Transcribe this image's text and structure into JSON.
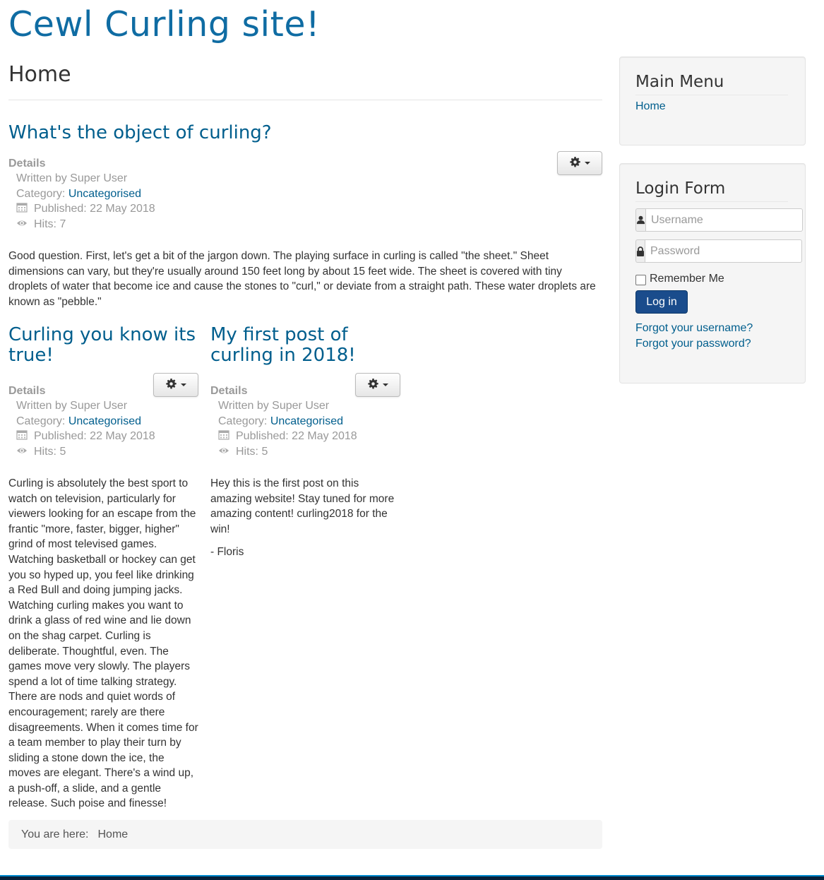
{
  "site": {
    "title": "Cewl Curling site!"
  },
  "page": {
    "title": "Home"
  },
  "articles": [
    {
      "title": "What's the object of curling?",
      "details_label": "Details",
      "author": "Written by Super User",
      "category_label": "Category:",
      "category": "Uncategorised",
      "published": "Published: 22 May 2018",
      "hits": "Hits: 7",
      "body": "Good question. First, let's get a bit of the jargon down. The playing surface in curling is called \"the sheet.\" Sheet dimensions can vary, but they're usually around 150 feet long by about 15 feet wide. The sheet is covered with tiny droplets of water that become ice and cause the stones to \"curl,\" or deviate from a straight path. These water droplets are known as \"pebble.\""
    },
    {
      "title": "Curling you know its true!",
      "details_label": "Details",
      "author": "Written by Super User",
      "category_label": "Category:",
      "category": "Uncategorised",
      "published": "Published: 22 May 2018",
      "hits": "Hits: 5",
      "body": "Curling is absolutely the best sport to watch on television, particularly for viewers looking for an escape from the frantic \"more, faster, bigger, higher\" grind of most televised games. Watching basketball or hockey can get you so hyped up, you feel like drinking a Red Bull and doing jumping jacks. Watching curling makes you want to drink a glass of red wine and lie down on the shag carpet. Curling is deliberate. Thoughtful, even. The games move very slowly. The players spend a lot of time talking strategy. There are nods and quiet words of encouragement; rarely are there disagreements. When it comes time for a team member to play their turn by sliding a stone down the ice, the moves are elegant. There's a wind up, a push-off, a slide, and a gentle release. Such poise and finesse!"
    },
    {
      "title": "My first post of curling in 2018!",
      "details_label": "Details",
      "author": "Written by Super User",
      "category_label": "Category:",
      "category": "Uncategorised",
      "published": "Published: 22 May 2018",
      "hits": "Hits: 5",
      "body": "Hey this is the first post on this amazing website! Stay tuned for more amazing content! curling2018 for the win!",
      "signature": "- Floris"
    }
  ],
  "main_menu": {
    "title": "Main Menu",
    "items": [
      "Home"
    ]
  },
  "login": {
    "title": "Login Form",
    "username_placeholder": "Username",
    "password_placeholder": "Password",
    "remember_label": "Remember Me",
    "login_button": "Log in",
    "forgot_username": "Forgot your username?",
    "forgot_password": "Forgot your password?"
  },
  "breadcrumb": {
    "prefix": "You are here:",
    "current": "Home"
  },
  "colors": {
    "link": "#005e8d",
    "title": "#0f6ca3",
    "button": "#1a4c8c",
    "footer": "#08213a"
  }
}
